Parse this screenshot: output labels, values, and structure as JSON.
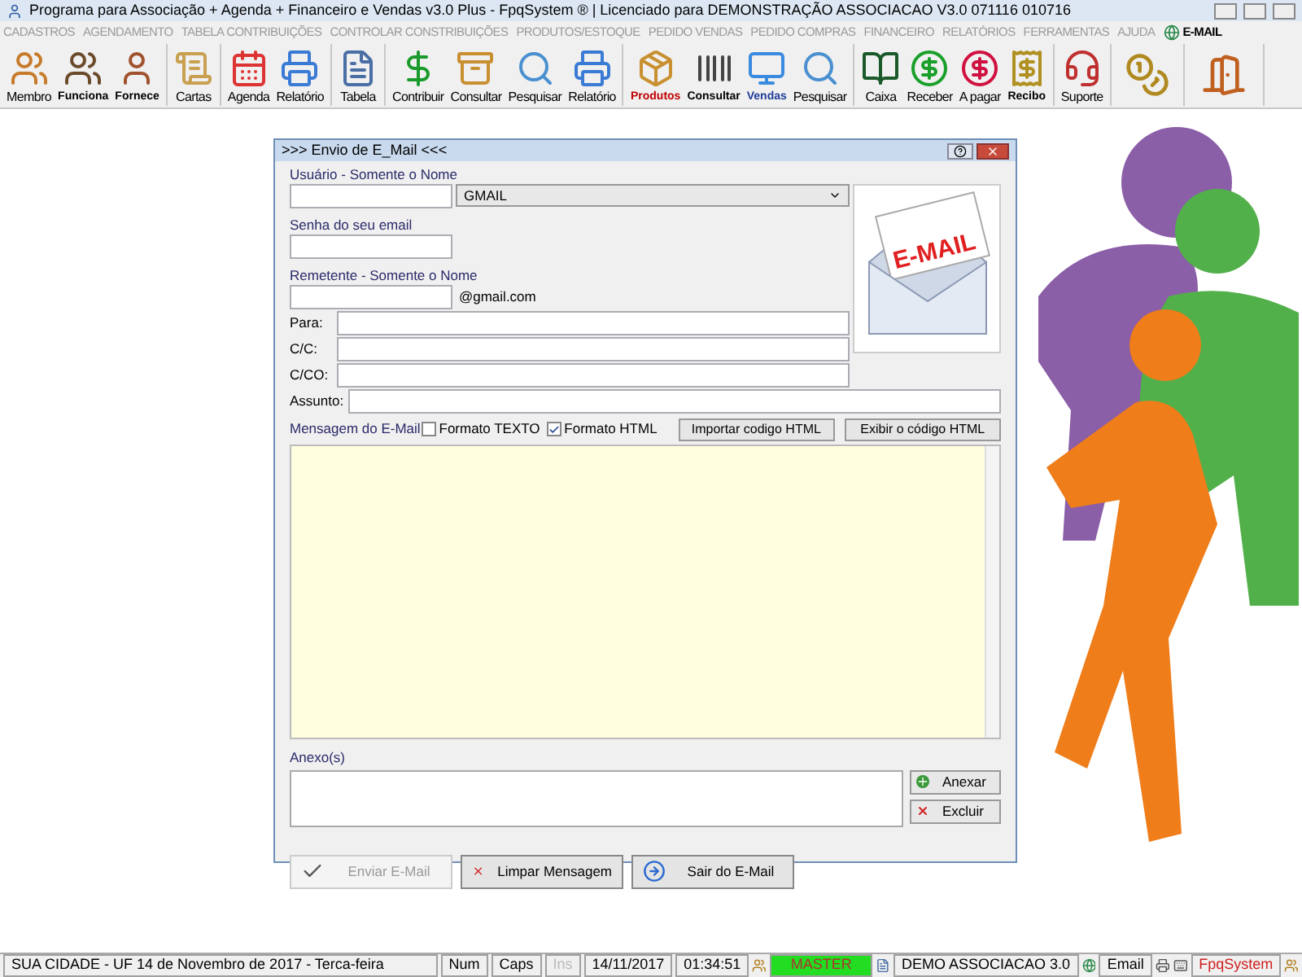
{
  "window": {
    "title": "Programa para Associação + Agenda + Financeiro e Vendas v3.0 Plus - FpqSystem ® | Licenciado para  DEMONSTRAÇÃO ASSOCIACAO V3.0 071116 010716"
  },
  "menu": [
    {
      "label": "CADASTROS",
      "disabled": true
    },
    {
      "label": "AGENDAMENTO",
      "disabled": true
    },
    {
      "label": "TABELA CONTRIBUIÇÕES",
      "disabled": true
    },
    {
      "label": "CONTROLAR CONSTRIBUIÇÕES",
      "disabled": true
    },
    {
      "label": "PRODUTOS/ESTOQUE",
      "disabled": true
    },
    {
      "label": "PEDIDO VENDAS",
      "disabled": true
    },
    {
      "label": "PEDIDO COMPRAS",
      "disabled": true
    },
    {
      "label": "FINANCEIRO",
      "disabled": true
    },
    {
      "label": "RELATÓRIOS",
      "disabled": true
    },
    {
      "label": "FERRAMENTAS",
      "disabled": true
    },
    {
      "label": "AJUDA",
      "disabled": true
    },
    {
      "label": "E-MAIL",
      "disabled": false
    }
  ],
  "toolbar": [
    [
      {
        "label": "Membro",
        "kind": "plain"
      },
      {
        "label": "Funciona",
        "kind": "bold",
        "color": "#000000"
      },
      {
        "label": "Fornece",
        "kind": "bold",
        "color": "#000000"
      }
    ],
    [
      {
        "label": "Cartas",
        "kind": "plain"
      }
    ],
    [
      {
        "label": "Agenda",
        "kind": "plain"
      },
      {
        "label": "Relatório",
        "kind": "plain"
      }
    ],
    [
      {
        "label": "Tabela",
        "kind": "plain"
      }
    ],
    [
      {
        "label": "Contribuir",
        "kind": "plain"
      },
      {
        "label": "Consultar",
        "kind": "plain"
      },
      {
        "label": "Pesquisar",
        "kind": "plain"
      },
      {
        "label": "Relatório",
        "kind": "plain"
      }
    ],
    [
      {
        "label": "Produtos",
        "kind": "bold",
        "color": "#c00000"
      },
      {
        "label": "Consultar",
        "kind": "bold",
        "color": "#000000"
      },
      {
        "label": "Vendas",
        "kind": "bold",
        "color": "#1f3d99"
      },
      {
        "label": "Pesquisar",
        "kind": "plain"
      }
    ],
    [
      {
        "label": "Caixa",
        "kind": "plain"
      },
      {
        "label": "Receber",
        "kind": "plain"
      },
      {
        "label": "A pagar",
        "kind": "plain"
      },
      {
        "label": "Recibo",
        "kind": "bold",
        "color": "#000000"
      }
    ],
    [
      {
        "label": "Suporte",
        "kind": "plain"
      }
    ]
  ],
  "dialog": {
    "title": ">>> Envio de E_Mail <<<",
    "user_label": "Usuário - Somente o Nome",
    "provider": "GMAIL",
    "password_label": "Senha do seu email",
    "sender_label": "Remetente - Somente o Nome",
    "domain": "@gmail.com",
    "image_text": "E-MAIL",
    "recipients": [
      {
        "label": "Para:"
      },
      {
        "label": "C/C:"
      },
      {
        "label": "C/CO:"
      }
    ],
    "subject_label": "Assunto:",
    "message_label": "Mensagem do E-Mail",
    "formats": [
      {
        "label": "Formato TEXTO",
        "checked": false
      },
      {
        "label": "Formato HTML",
        "checked": true
      }
    ],
    "html_buttons": [
      "Importar codigo HTML",
      "Exibir o código HTML"
    ],
    "attachments_label": "Anexo(s)",
    "attach_buttons": [
      "Anexar",
      "Excluir"
    ],
    "actions": [
      {
        "label": "Enviar E-Mail",
        "disabled": true
      },
      {
        "label": "Limpar Mensagem",
        "disabled": false
      },
      {
        "label": "Sair do E-Mail",
        "disabled": false
      }
    ]
  },
  "status_bar": {
    "location": "SUA CIDADE - UF 14 de Novembro de 2017 - Terca-feira",
    "num": "Num",
    "caps": "Caps",
    "ins": {
      "label": "Ins",
      "disabled": true
    },
    "date": "14/11/2017",
    "time": "01:34:51",
    "user": "MASTER",
    "license": "DEMO ASSOCIACAO 3.0",
    "email": "Email",
    "brand": "FpqSystem"
  }
}
